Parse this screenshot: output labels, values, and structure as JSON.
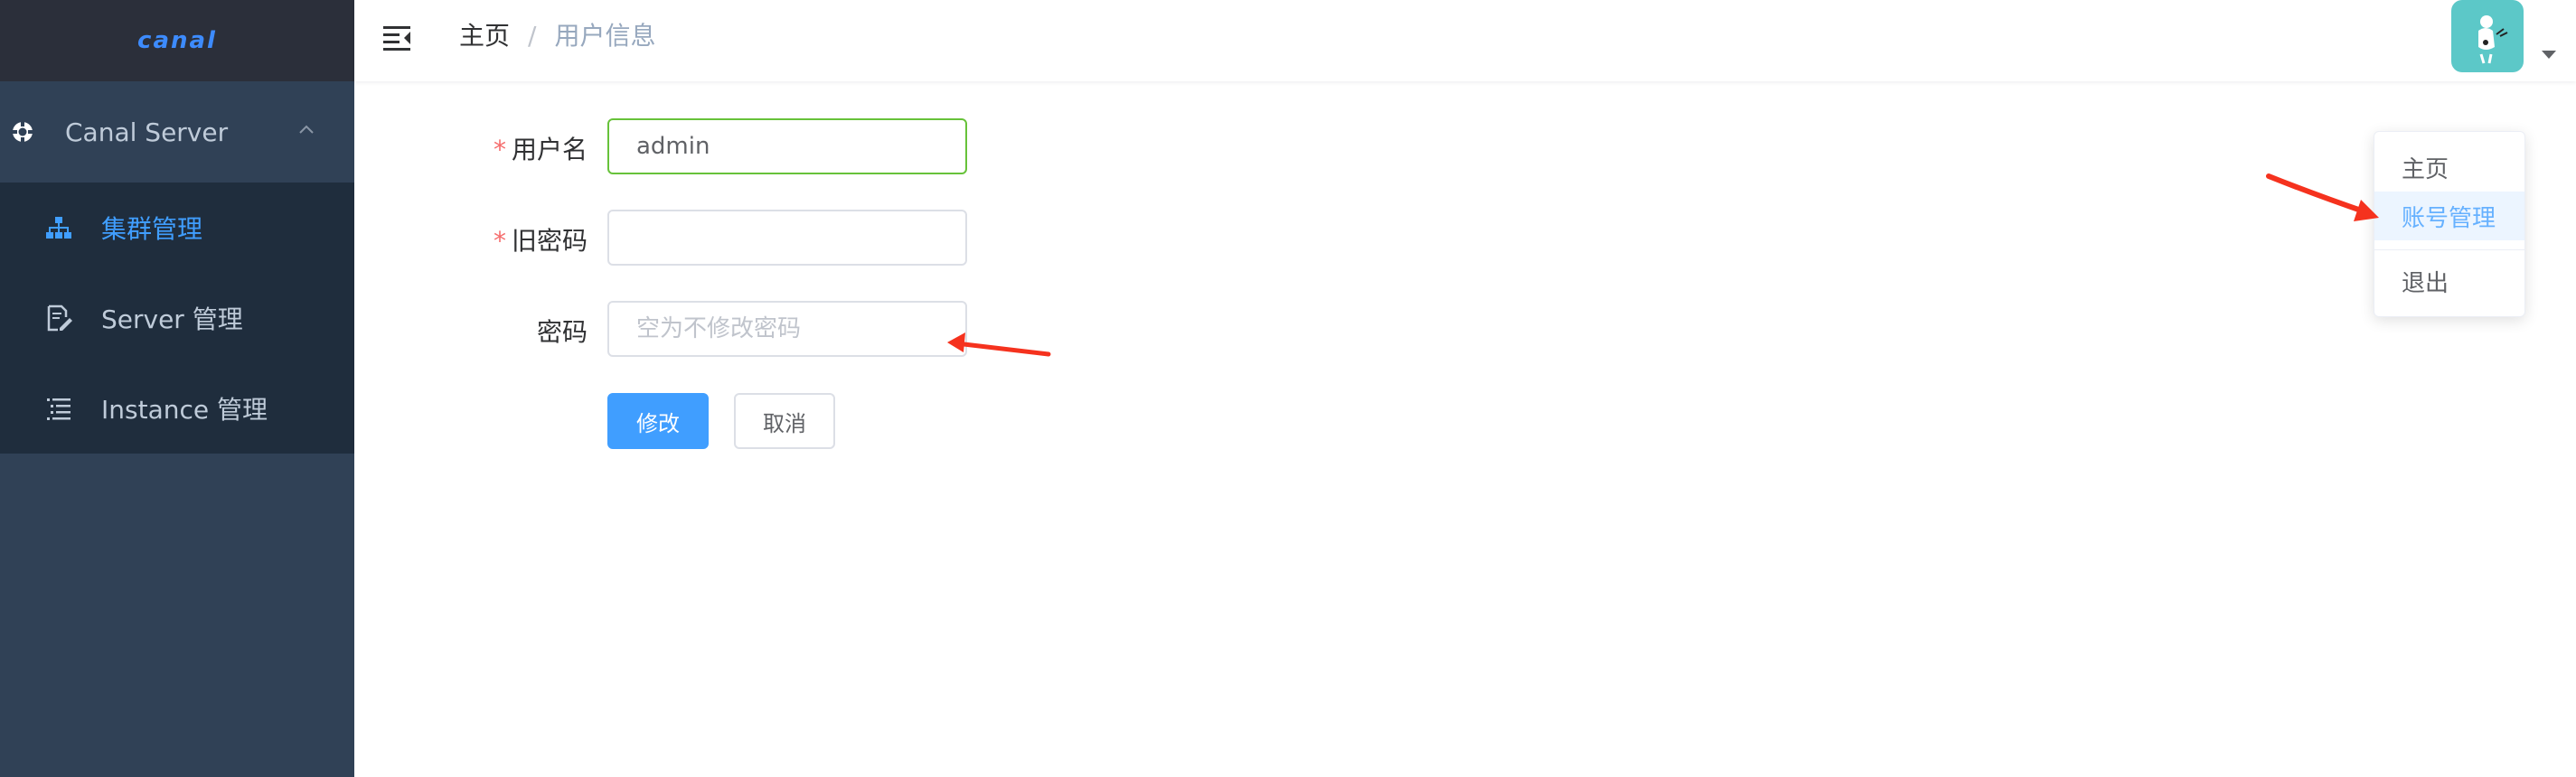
{
  "app": {
    "logo": "canal",
    "brand_color": "#3d8bfd"
  },
  "sidebar": {
    "group": {
      "label": "Canal Server",
      "icon": "gear-icon",
      "expanded": true
    },
    "items": [
      {
        "label": "集群管理",
        "icon": "cluster-icon",
        "active": true
      },
      {
        "label": "Server 管理",
        "icon": "server-edit-icon",
        "active": false
      },
      {
        "label": "Instance 管理",
        "icon": "list-icon",
        "active": false
      }
    ]
  },
  "header": {
    "breadcrumb": {
      "home": "主页",
      "separator": "/",
      "current": "用户信息"
    }
  },
  "user_menu": {
    "items": [
      "主页",
      "账号管理",
      "退出"
    ],
    "highlighted": "账号管理"
  },
  "form": {
    "username": {
      "label": "用户名",
      "required": true,
      "value": "admin"
    },
    "old_password": {
      "label": "旧密码",
      "required": true,
      "value": ""
    },
    "password": {
      "label": "密码",
      "required": false,
      "value": "",
      "placeholder": "空为不修改密码"
    },
    "submit_label": "修改",
    "cancel_label": "取消"
  },
  "colors": {
    "primary": "#409eff",
    "success": "#67c23a",
    "danger": "#f56c6c",
    "annotation": "#f5321e"
  }
}
